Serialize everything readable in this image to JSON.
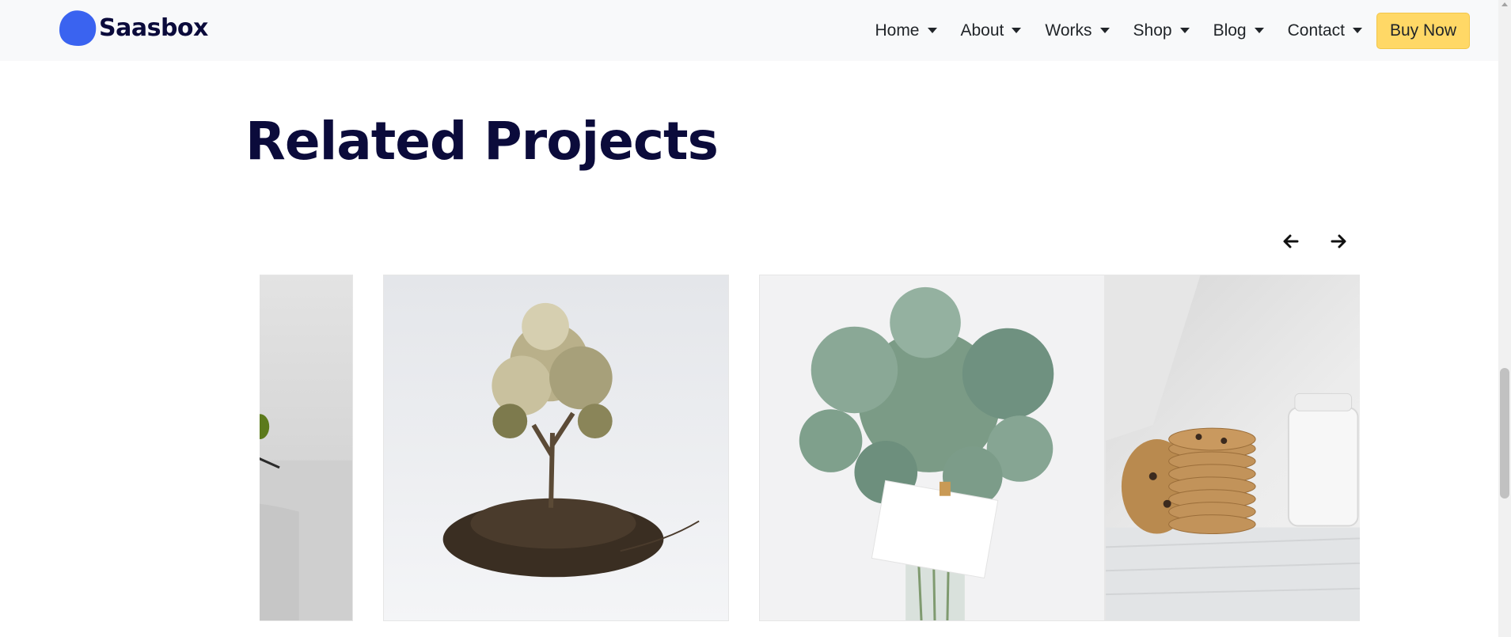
{
  "brand": {
    "name": "Saasbox",
    "logo_color": "#3a63f0"
  },
  "nav": {
    "items": [
      {
        "label": "Home"
      },
      {
        "label": "About"
      },
      {
        "label": "Works"
      },
      {
        "label": "Shop"
      },
      {
        "label": "Blog"
      },
      {
        "label": "Contact"
      }
    ],
    "cta_label": "Buy Now",
    "cta_color": "#ffd866"
  },
  "section": {
    "title": "Related Projects"
  },
  "carousel": {
    "prev_icon": "arrow-left-icon",
    "next_icon": "arrow-right-icon",
    "slides": [
      {
        "image": "plant-leaf-partial"
      },
      {
        "image": "tree-with-roots-in-soil"
      },
      {
        "image": "eucalyptus-bouquet-with-card"
      },
      {
        "image": "cookies-and-milk-jar"
      }
    ]
  },
  "colors": {
    "heading": "#0b0b3b",
    "navbar_bg": "#f8f9fa"
  }
}
